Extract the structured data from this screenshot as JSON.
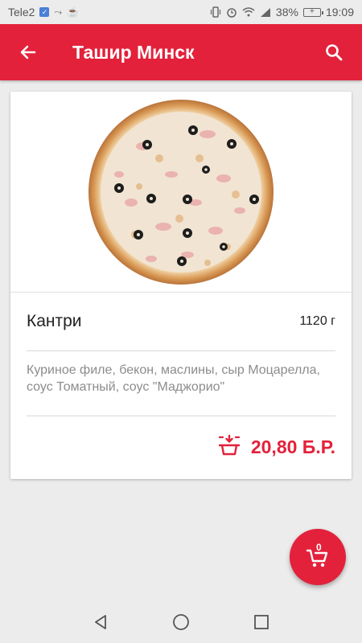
{
  "status_bar": {
    "carrier": "Tele2",
    "battery_percent": "38%",
    "time": "19:09",
    "icons": [
      "sim-icon",
      "signal-location-icon",
      "coffee-icon",
      "vibrate-icon",
      "alarm-icon",
      "wifi-icon",
      "signal-icon",
      "battery-icon"
    ]
  },
  "app_bar": {
    "title": "Ташир Минск",
    "back_icon": "arrow-left-icon",
    "search_icon": "search-icon"
  },
  "product": {
    "name": "Кантри",
    "weight": "1120 г",
    "description": "Куриное филе, бекон, маслины, сыр Моцарелла, соус Томатный, соус \"Маджорио\"",
    "price": "20,80 Б.Р.",
    "add_to_cart_icon": "basket-add-icon"
  },
  "fab": {
    "cart_count": "0",
    "icon": "cart-icon"
  },
  "colors": {
    "brand": "#e3213b",
    "background": "#ececec"
  }
}
